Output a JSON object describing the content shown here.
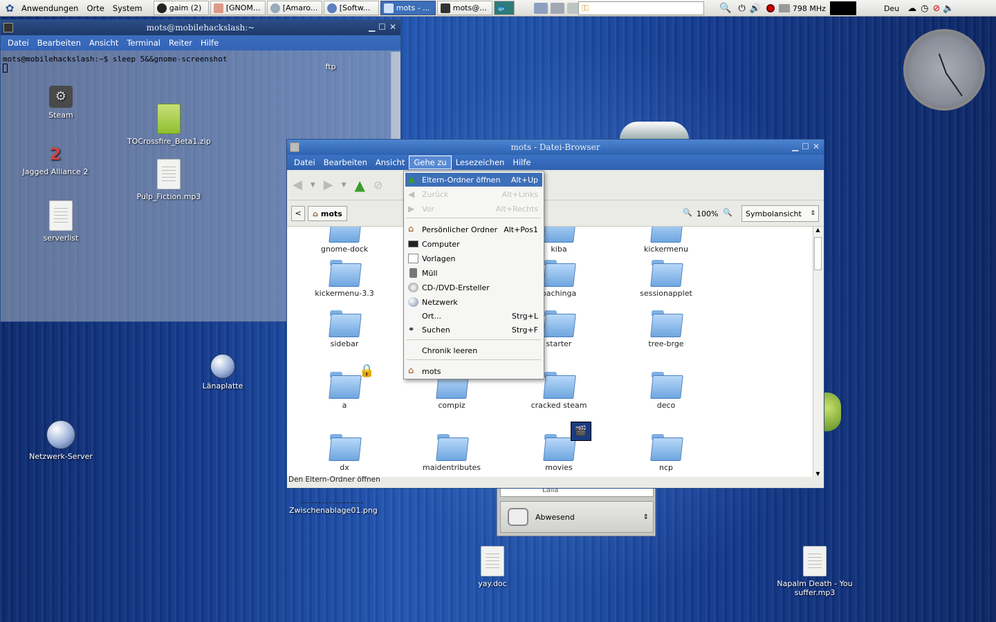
{
  "panel": {
    "menus": [
      "Anwendungen",
      "Orte",
      "System"
    ],
    "tasks": [
      {
        "label": "gaim (2)",
        "icon": "penguin-icon"
      },
      {
        "label": "[GNOM...",
        "icon": "browser-icon"
      },
      {
        "label": "[Amaro...",
        "icon": "amarok-icon"
      },
      {
        "label": "[Softw...",
        "icon": "firefox-icon"
      },
      {
        "label": "mots - ...",
        "icon": "folder-icon"
      },
      {
        "label": "mots@...",
        "icon": "terminal-icon"
      }
    ],
    "cpu_freq": "798 MHz",
    "keyboard_layout": "Deu"
  },
  "terminal": {
    "title": "mots@mobilehackslash:~",
    "menu": [
      "Datei",
      "Bearbeiten",
      "Ansicht",
      "Terminal",
      "Reiter",
      "Hilfe"
    ],
    "line": "mots@mobilehackslash:~$ sleep 5&&gnome-screenshot"
  },
  "desktop_icons": {
    "steam": "Steam",
    "ja2": "Jagged Alliance 2",
    "serverlist": "serverlist",
    "tocrossfire": "TOCrossfire_Beta1.zip",
    "pulp": "Pulp_Fiction.mp3",
    "ftp": "ftp",
    "lanaplatte": "Länaplatte",
    "netzwerk": "Netzwerk-Server",
    "clip": "Zwischenablage01.png",
    "yay": "yay.doc",
    "napalm": "Napalm Death - You suffer.mp3"
  },
  "filebrowser": {
    "title": "mots - Datei-Browser",
    "menu": [
      "Datei",
      "Bearbeiten",
      "Ansicht",
      "Gehe zu",
      "Lesezeichen",
      "Hilfe"
    ],
    "path_button": "mots",
    "zoom": "100%",
    "view_mode": "Symbolansicht",
    "status": "Den Eltern-Ordner öffnen",
    "items": [
      "gnome-dock",
      "kiba",
      "kickermenu",
      "kickermenu-3.3",
      "pachinga",
      "sessionapplet",
      "sidebar",
      "starter",
      "tree-brge",
      "a",
      "compiz",
      "cracked steam",
      "deco",
      "dx",
      "maidentributes",
      "movies",
      "ncp"
    ]
  },
  "goto_menu": {
    "items": [
      {
        "label": "Eltern-Ordner öffnen",
        "accel": "Alt+Up",
        "icon": "up-arrow-icon",
        "state": "selected"
      },
      {
        "label": "Zurück",
        "accel": "Alt+Links",
        "icon": "back-arrow-icon",
        "state": "disabled"
      },
      {
        "label": "Vor",
        "accel": "Alt+Rechts",
        "icon": "forward-arrow-icon",
        "state": "disabled"
      },
      {
        "label": "Persönlicher Ordner",
        "accel": "Alt+Pos1",
        "icon": "home-icon",
        "state": "normal"
      },
      {
        "label": "Computer",
        "accel": "",
        "icon": "monitor-icon",
        "state": "normal"
      },
      {
        "label": "Vorlagen",
        "accel": "",
        "icon": "template-icon",
        "state": "normal"
      },
      {
        "label": "Müll",
        "accel": "",
        "icon": "trash-icon",
        "state": "normal"
      },
      {
        "label": "CD-/DVD-Ersteller",
        "accel": "",
        "icon": "cd-icon",
        "state": "normal"
      },
      {
        "label": "Netzwerk",
        "accel": "",
        "icon": "network-icon",
        "state": "normal"
      },
      {
        "label": "Ort...",
        "accel": "Strg+L",
        "icon": "",
        "state": "normal"
      },
      {
        "label": "Suchen",
        "accel": "Strg+F",
        "icon": "binoculars-icon",
        "state": "normal"
      },
      {
        "label": "Chronik leeren",
        "accel": "",
        "icon": "",
        "state": "normal"
      },
      {
        "label": "mots",
        "accel": "",
        "icon": "home-icon",
        "state": "normal"
      }
    ]
  },
  "gaim_status": {
    "status": "Abwesend",
    "partial": "Lalia"
  }
}
